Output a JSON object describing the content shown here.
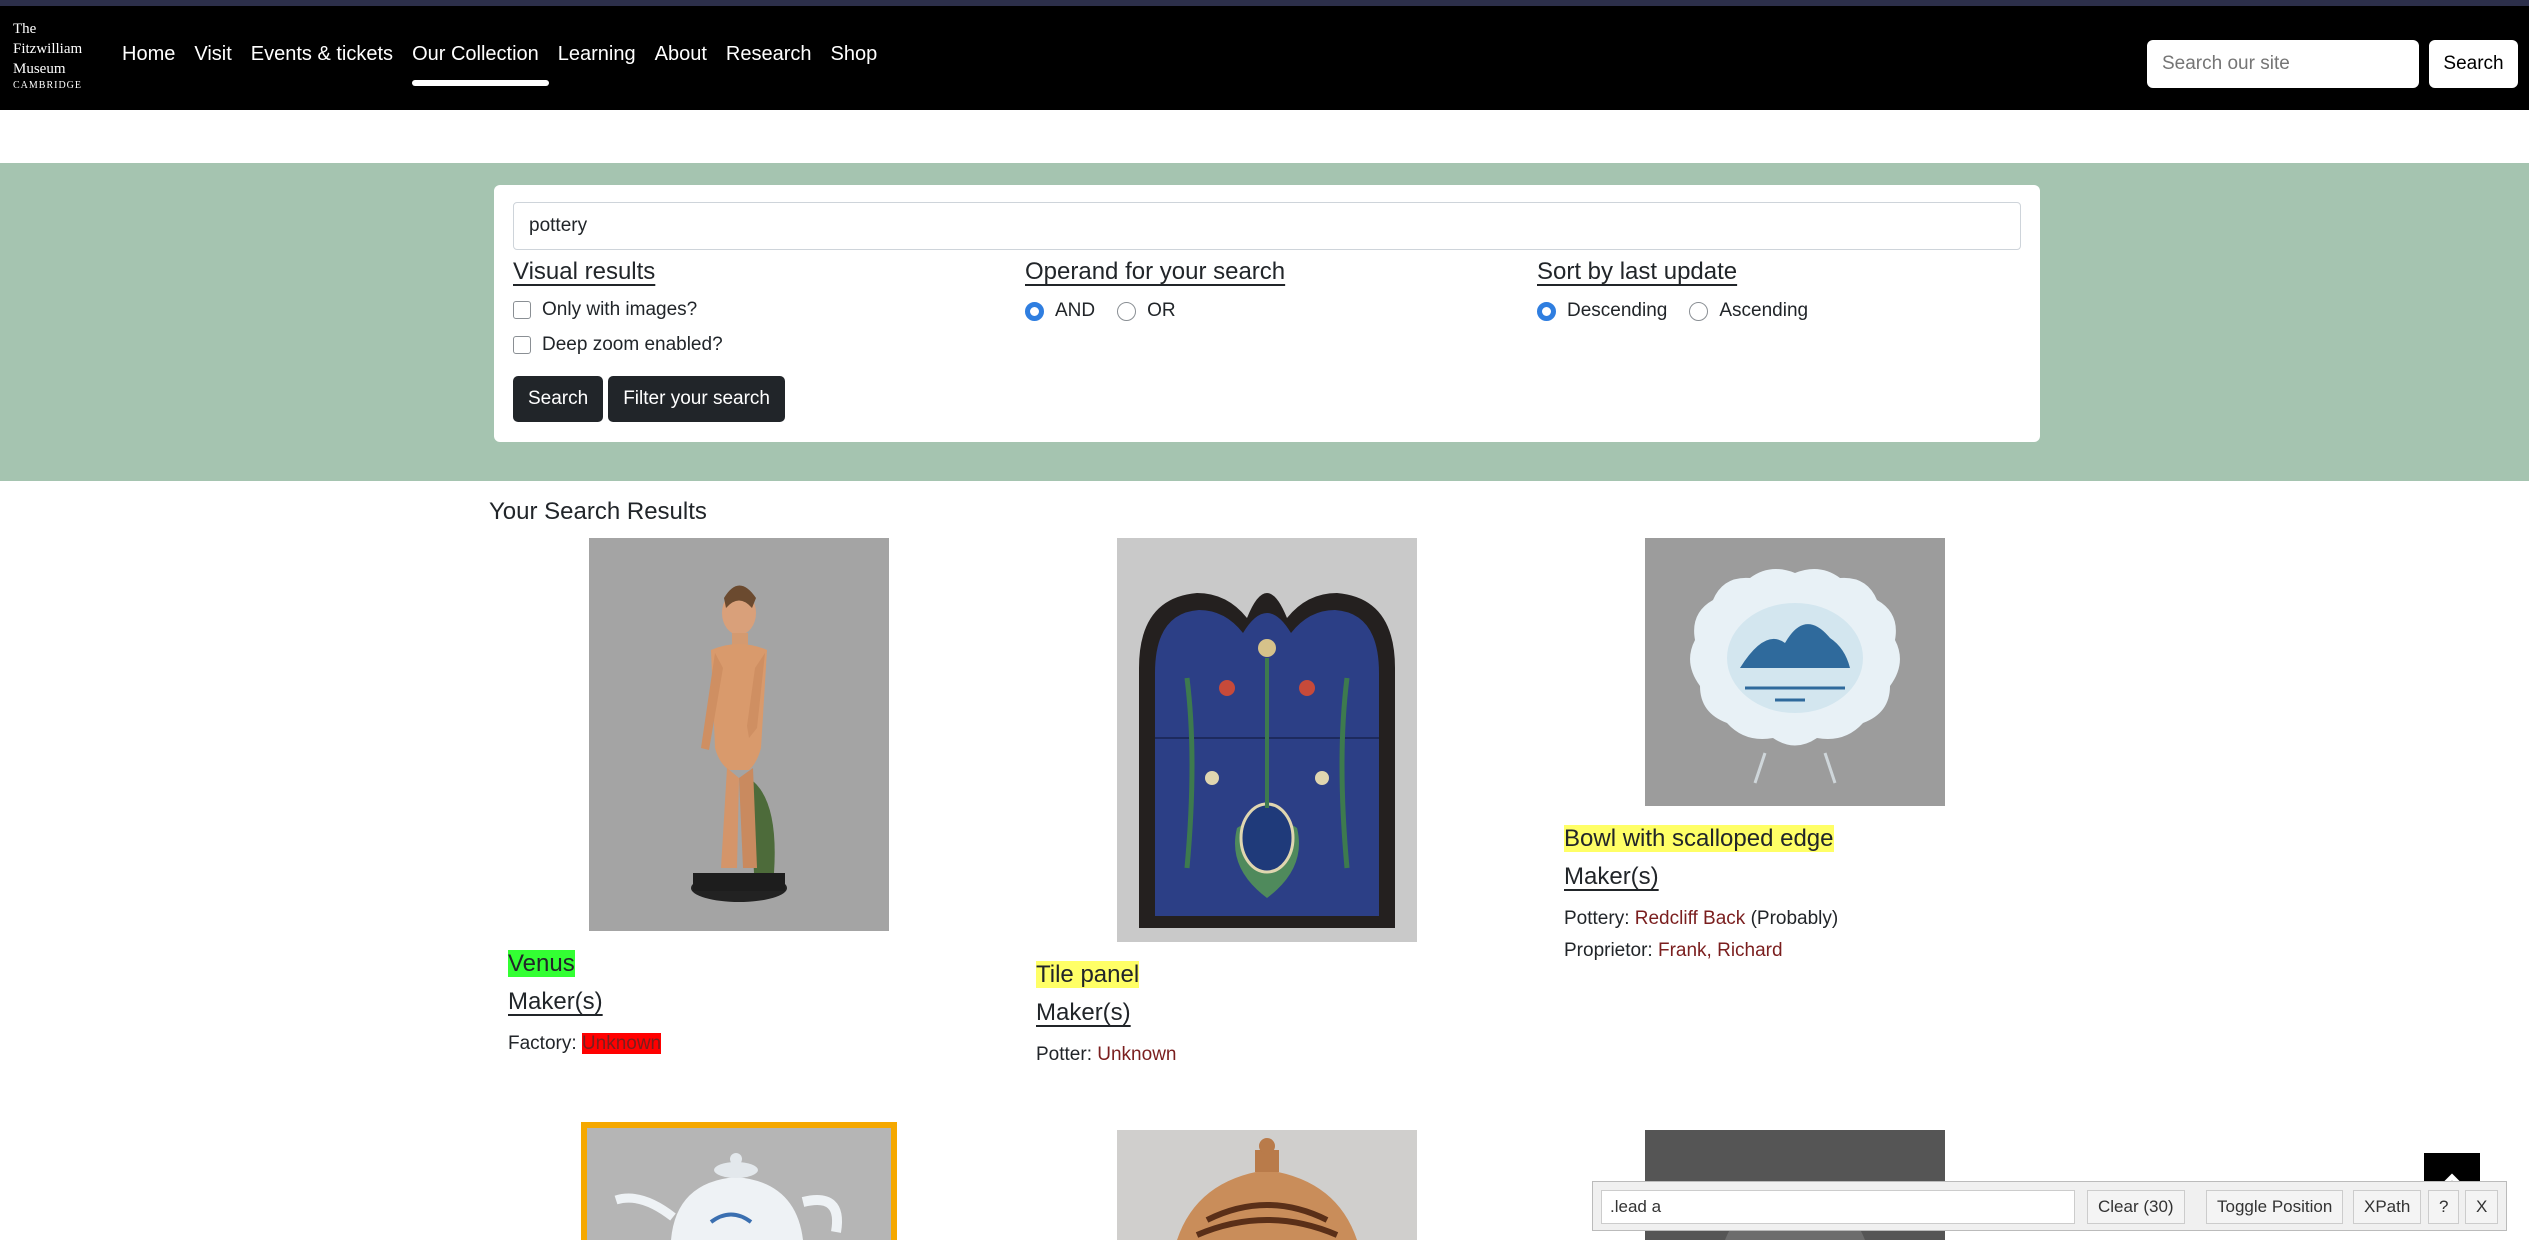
{
  "logo": {
    "line1": "The",
    "line2": "Fitzwilliam",
    "line3": "Museum",
    "line4": "CAMBRIDGE"
  },
  "nav": [
    "Home",
    "Visit",
    "Events & tickets",
    "Our Collection",
    "Learning",
    "About",
    "Research",
    "Shop"
  ],
  "nav_active": "Our Collection",
  "site_search": {
    "placeholder": "Search our site",
    "button": "Search"
  },
  "search": {
    "query": "pottery",
    "visual_title": "Visual results",
    "images_label": "Only with images?",
    "zoom_label": "Deep zoom enabled?",
    "operand_title": "Operand for your search",
    "and_label": "AND",
    "or_label": "OR",
    "sort_title": "Sort by last update",
    "desc_label": "Descending",
    "asc_label": "Ascending",
    "search_button": "Search",
    "filter_button": "Filter your search"
  },
  "results": {
    "heading": "Your Search Results",
    "items": [
      {
        "title": "Venus",
        "maker": "Maker(s)",
        "role": "Factory:",
        "name": "Unknown",
        "extra": ""
      },
      {
        "title": "Tile panel",
        "maker": "Maker(s)",
        "role": "Potter:",
        "name": "Unknown",
        "extra": ""
      },
      {
        "title": "Bowl with scalloped edge",
        "maker": "Maker(s)",
        "role": "Pottery:",
        "name": "Redcliff Back",
        "extra": "(Probably)",
        "role2": "Proprietor:",
        "name2": "Frank, Richard"
      }
    ]
  },
  "devtool": {
    "input": ".lead a",
    "clear": "Clear (30)",
    "toggle": "Toggle Position",
    "xpath": "XPath",
    "help": "?",
    "close": "X"
  },
  "colors": {
    "navbar": "#000000",
    "band": "#a5c4b0",
    "highlight_yellow": "#ffff66",
    "highlight_green": "#33ff33",
    "highlight_red": "#ff0000",
    "link": "#7a1e1e"
  }
}
